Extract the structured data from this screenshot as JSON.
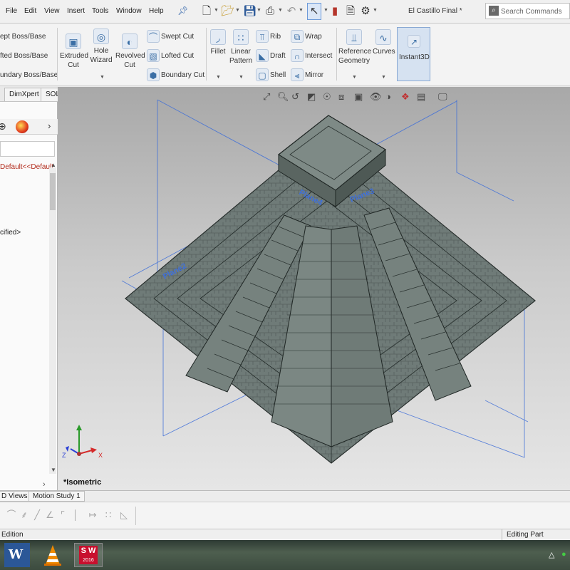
{
  "menu": {
    "items": [
      "File",
      "Edit",
      "View",
      "Insert",
      "Tools",
      "Window",
      "Help"
    ],
    "document_title": "El Castillo Final *",
    "search_placeholder": "Search Commands"
  },
  "ribbon": {
    "boss_column": [
      "ept Boss/Base",
      "fted Boss/Base",
      "undary Boss/Base"
    ],
    "extruded_cut": [
      "Extruded",
      "Cut"
    ],
    "hole_wizard": [
      "Hole",
      "Wizard"
    ],
    "revolved_cut": [
      "Revolved",
      "Cut"
    ],
    "cut_column": [
      "Swept Cut",
      "Lofted Cut",
      "Boundary Cut"
    ],
    "fillet": "Fillet",
    "linear_pattern": [
      "Linear",
      "Pattern"
    ],
    "feature_column_1": [
      "Rib",
      "Draft",
      "Shell"
    ],
    "feature_column_2": [
      "Wrap",
      "Intersect",
      "Mirror"
    ],
    "reference_geometry": [
      "Reference",
      "Geometry"
    ],
    "curves": "Curves",
    "instant3d": "Instant3D"
  },
  "tabs": [
    "DimXpert",
    "SOLIDWORKS MBD"
  ],
  "left_panel": {
    "config_text": "Default<<Default",
    "material_text": "cified>"
  },
  "viewport": {
    "view_label": "*Isometric",
    "triad_axes": [
      "Z",
      "X"
    ],
    "plane_labels": [
      "Plane4",
      "Plane3",
      "Plane2"
    ]
  },
  "bottom_tabs": [
    "D Views",
    "Motion Study 1"
  ],
  "status": {
    "left": "Edition",
    "right": "Editing Part"
  },
  "taskbar": {
    "word_letter": "W",
    "sw_label": "S W",
    "sw_year": "2016"
  },
  "colors": {
    "stone": "#5f6c68",
    "stone_light": "#7d8a86",
    "plane_blue": "#3f6fd8",
    "highlight": "#dbe7f7"
  }
}
